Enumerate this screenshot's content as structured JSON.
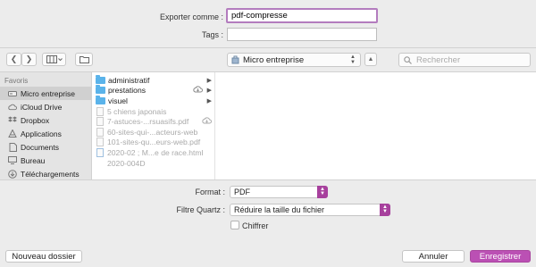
{
  "export": {
    "name_label": "Exporter comme :",
    "name_value": "pdf-compresse",
    "tags_label": "Tags :",
    "tags_value": ""
  },
  "toolbar": {
    "back_icon": "chevron-left-icon",
    "forward_icon": "chevron-right-icon",
    "view_icon": "columns-icon",
    "new_folder_icon": "folder-icon",
    "location": "Micro entreprise",
    "search_placeholder": "Rechercher"
  },
  "sidebar": {
    "heading": "Favoris",
    "items": [
      {
        "label": "Micro entreprise",
        "icon": "hard-drive-icon",
        "selected": true
      },
      {
        "label": "iCloud Drive",
        "icon": "cloud-icon",
        "selected": false
      },
      {
        "label": "Dropbox",
        "icon": "dropbox-icon",
        "selected": false
      },
      {
        "label": "Applications",
        "icon": "applications-icon",
        "selected": false
      },
      {
        "label": "Documents",
        "icon": "documents-icon",
        "selected": false
      },
      {
        "label": "Bureau",
        "icon": "desktop-icon",
        "selected": false
      },
      {
        "label": "Téléchargements",
        "icon": "downloads-icon",
        "selected": false
      }
    ]
  },
  "files": [
    {
      "name": "administratif",
      "kind": "folder",
      "cloud": false
    },
    {
      "name": "prestations",
      "kind": "folder",
      "cloud": true
    },
    {
      "name": "visuel",
      "kind": "folder",
      "cloud": false
    },
    {
      "name": "5 chiens japonais",
      "kind": "file",
      "cloud": false
    },
    {
      "name": "7-astuces-...rsuasifs.pdf",
      "kind": "file",
      "cloud": true
    },
    {
      "name": "60-sites-qui-...acteurs-web",
      "kind": "file",
      "cloud": false
    },
    {
      "name": "101-sites-qu...eurs-web.pdf",
      "kind": "file",
      "cloud": false
    },
    {
      "name": "2020-02 ; M...e de race.html",
      "kind": "file",
      "cloud": false
    },
    {
      "name": "2020-004D",
      "kind": "file",
      "cloud": false
    }
  ],
  "options": {
    "format_label": "Format :",
    "format_value": "PDF",
    "quartz_label": "Filtre Quartz :",
    "quartz_value": "Réduire la taille du fichier",
    "encrypt_label": "Chiffrer"
  },
  "buttons": {
    "new_folder": "Nouveau dossier",
    "cancel": "Annuler",
    "save": "Enregistrer"
  },
  "colors": {
    "accent": "#bb50b4",
    "folder": "#5ab3ea"
  }
}
